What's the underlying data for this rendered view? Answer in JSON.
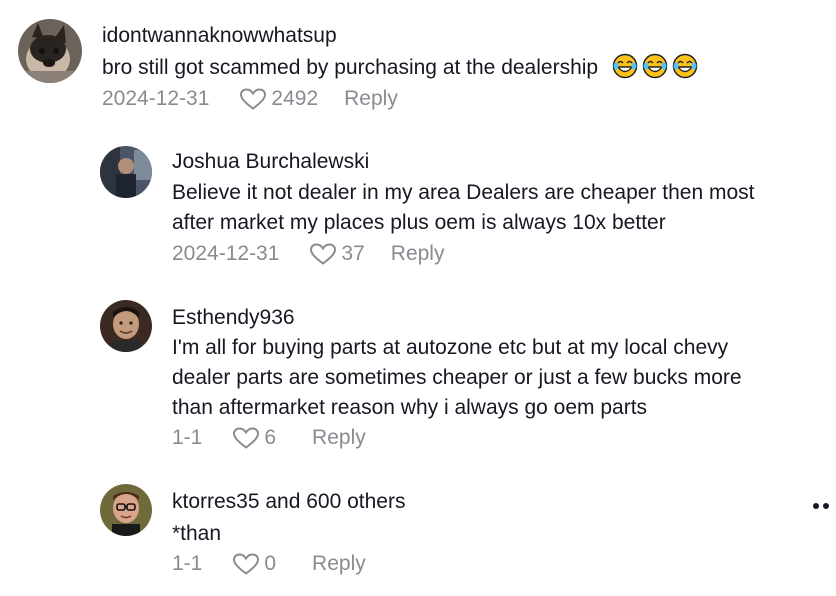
{
  "comments": [
    {
      "username": "idontwannaknowwhatsup",
      "text_lines": [
        "bro still got scammed by purchasing at the dealership"
      ],
      "emoji": [
        "face-with-tears-of-joy",
        "face-with-tears-of-joy",
        "face-with-tears-of-joy"
      ],
      "date": "2024-12-31",
      "likes": "2492",
      "reply_label": "Reply"
    },
    {
      "username": "Joshua Burchalewski",
      "text_lines": [
        "Believe it not dealer in my area Dealers are cheaper then most",
        "after market my places plus oem is always 10x better"
      ],
      "date": "2024-12-31",
      "likes": "37",
      "reply_label": "Reply"
    },
    {
      "username": "Esthendy936",
      "text_lines": [
        "I'm all for buying parts at autozone etc but at my local chevy",
        "dealer parts are sometimes cheaper or just a few bucks more",
        "than aftermarket reason why i always go oem parts"
      ],
      "date": "1-1",
      "likes": "6",
      "reply_label": "Reply"
    },
    {
      "username": "ktorres35 and 600 others",
      "text_lines": [
        "*than"
      ],
      "date": "1-1",
      "likes": "0",
      "reply_label": "Reply"
    }
  ],
  "more_icon": "more-dots-icon",
  "colors": {
    "text": "#161823",
    "meta": "#8a8b91",
    "background": "#ffffff"
  }
}
